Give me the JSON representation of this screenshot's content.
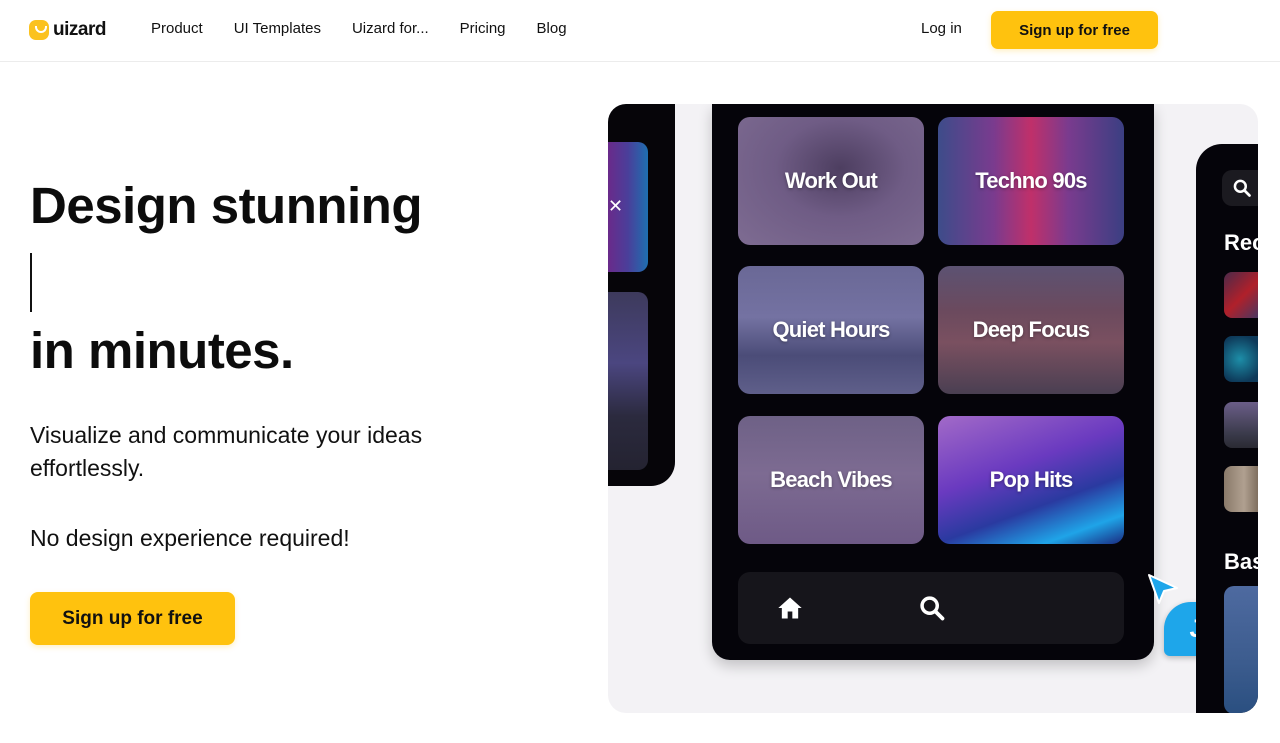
{
  "nav": {
    "logo_text": "uizard",
    "links": [
      "Product",
      "UI Templates",
      "Uizard for...",
      "Pricing",
      "Blog"
    ],
    "login_label": "Log in",
    "signup_label": "Sign up for free"
  },
  "hero": {
    "title_line1": "Design stunning",
    "title_line2": "in minutes.",
    "subtitle": "Visualize and communicate your ideas effortlessly.",
    "note": "No design experience required!",
    "cta_label": "Sign up for free"
  },
  "visual": {
    "tiles": [
      "Work Out",
      "Techno 90s",
      "Quiet Hours",
      "Deep Focus",
      "Beach Vibes",
      "Pop Hits"
    ],
    "tabbar_icons": [
      "home-icon",
      "search-icon"
    ],
    "cursor_user": "Joe",
    "right_phone_headings": [
      "Rec",
      "Bas"
    ]
  },
  "colors": {
    "brand_yellow": "#ffc20e",
    "cursor_blue": "#1ea6ea",
    "phone_bg": "#05040a"
  }
}
